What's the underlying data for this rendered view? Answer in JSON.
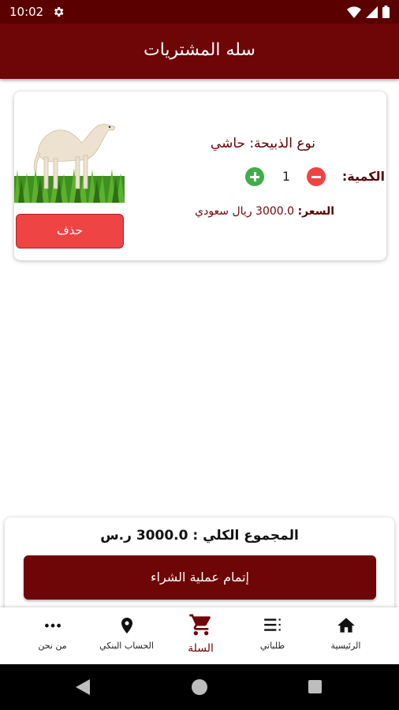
{
  "status_bar": {
    "time": "10:02",
    "icons": [
      "gear-icon",
      "wifi-icon",
      "cellular-icon",
      "battery-icon"
    ]
  },
  "app_bar": {
    "title": "سله المشتريات"
  },
  "cart_item": {
    "image_icon": "camel-image",
    "type_label": "نوع الذبيحة:",
    "type_value": "حاشي",
    "quantity_label": "الكمية:",
    "quantity_value": "1",
    "price_label": "السعر:",
    "price_value": "3000.0 ريال سعودي",
    "delete_label": "حذف"
  },
  "summary": {
    "total_label": "المجموع الكلي :",
    "total_value": "3000.0 ر.س",
    "checkout_label": "إتمام عملية الشراء"
  },
  "bottom_nav": {
    "items": [
      {
        "label": "الرئيسية",
        "icon": "home-icon"
      },
      {
        "label": "طلباتي",
        "icon": "list-icon"
      },
      {
        "label": "السلة",
        "icon": "cart-icon",
        "active": true
      },
      {
        "label": "الحساب البنكي",
        "icon": "location-pin-icon"
      },
      {
        "label": "من نحن",
        "icon": "more-dots-icon"
      }
    ]
  },
  "colors": {
    "primary": "#6e0506",
    "status_bar": "#5a0000",
    "delete": "#ef4444",
    "plus": "#3fae49",
    "minus": "#ef4444"
  }
}
